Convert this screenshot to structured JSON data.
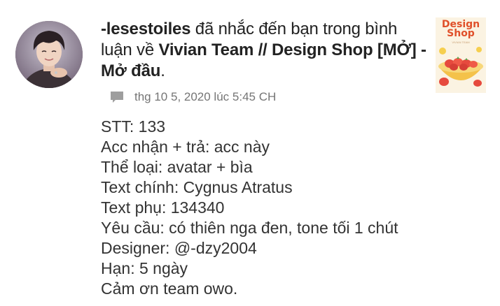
{
  "notification": {
    "actor": "-lesestoiles",
    "action_text": " đã nhắc đến bạn trong bình luận về ",
    "target": "Vivian Team // Design Shop [MỞ] - Mở đầu",
    "target_suffix": ".",
    "timestamp": "thg 10 5, 2020 lúc 5:45 CH",
    "thumbnail_title": "Design Shop",
    "thumbnail_subtitle": "VIVIAN TEAM",
    "body_lines": [
      "STT: 133",
      "Acc nhận + trả: acc này",
      "Thể loại: avatar + bìa",
      "Text chính: Cygnus Atratus",
      "Text phụ: 134340",
      "Yêu cầu: có thiên nga đen, tone tối 1 chút",
      "Designer: @-dzy2004",
      "Hạn: 5 ngày",
      "Cảm ơn team owo."
    ]
  },
  "icons": {
    "avatar": "user-avatar-photo",
    "meta": "comment-icon",
    "thumbnail": "story-cover-strawberries"
  },
  "colors": {
    "thumbnail_title": "#e0502a",
    "timestamp": "#757575",
    "text": "#333333"
  }
}
